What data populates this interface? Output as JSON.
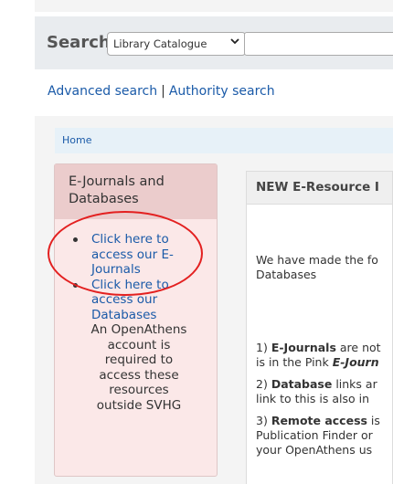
{
  "search": {
    "label": "Search",
    "scope_selected": "Library Catalogue",
    "input_value": ""
  },
  "links": {
    "advanced": "Advanced search",
    "separator": "|",
    "authority": "Authority search"
  },
  "breadcrumb": {
    "home": "Home"
  },
  "eresources_panel": {
    "title_line1": "E-Journals and",
    "title_line2": "Databases",
    "item1": [
      "Click here to",
      "access our E-",
      "Journals"
    ],
    "item2": [
      "Click here to",
      "access our",
      "Databases"
    ],
    "note": [
      "An OpenAthens",
      "account is",
      "required to",
      "access these",
      "resources",
      "outside SVHG"
    ]
  },
  "news_panel": {
    "title": "NEW E-Resource I",
    "lines": {
      "l1": "We have made the fo",
      "l2": "Databases",
      "l3_num": "1) ",
      "l3_bold": "E-Journals",
      "l3_rest": " are not",
      "l4_rest": "is in the Pink ",
      "l4_bold": "E-Journ",
      "l5_num": "2) ",
      "l5_bold": "Database",
      "l5_rest": " links ar",
      "l6": "link to this is also in",
      "l7_num": "3) ",
      "l7_bold": "Remote access",
      "l7_rest": " is",
      "l8": "Publication Finder or",
      "l9": "your OpenAthens us"
    }
  },
  "colors": {
    "link": "#1a5aa8",
    "pink_bg": "#fbe8e8",
    "pink_header": "#ebcccc",
    "annotation_red": "#e32020"
  },
  "icons": {
    "dropdown": "chevron-down-icon"
  }
}
